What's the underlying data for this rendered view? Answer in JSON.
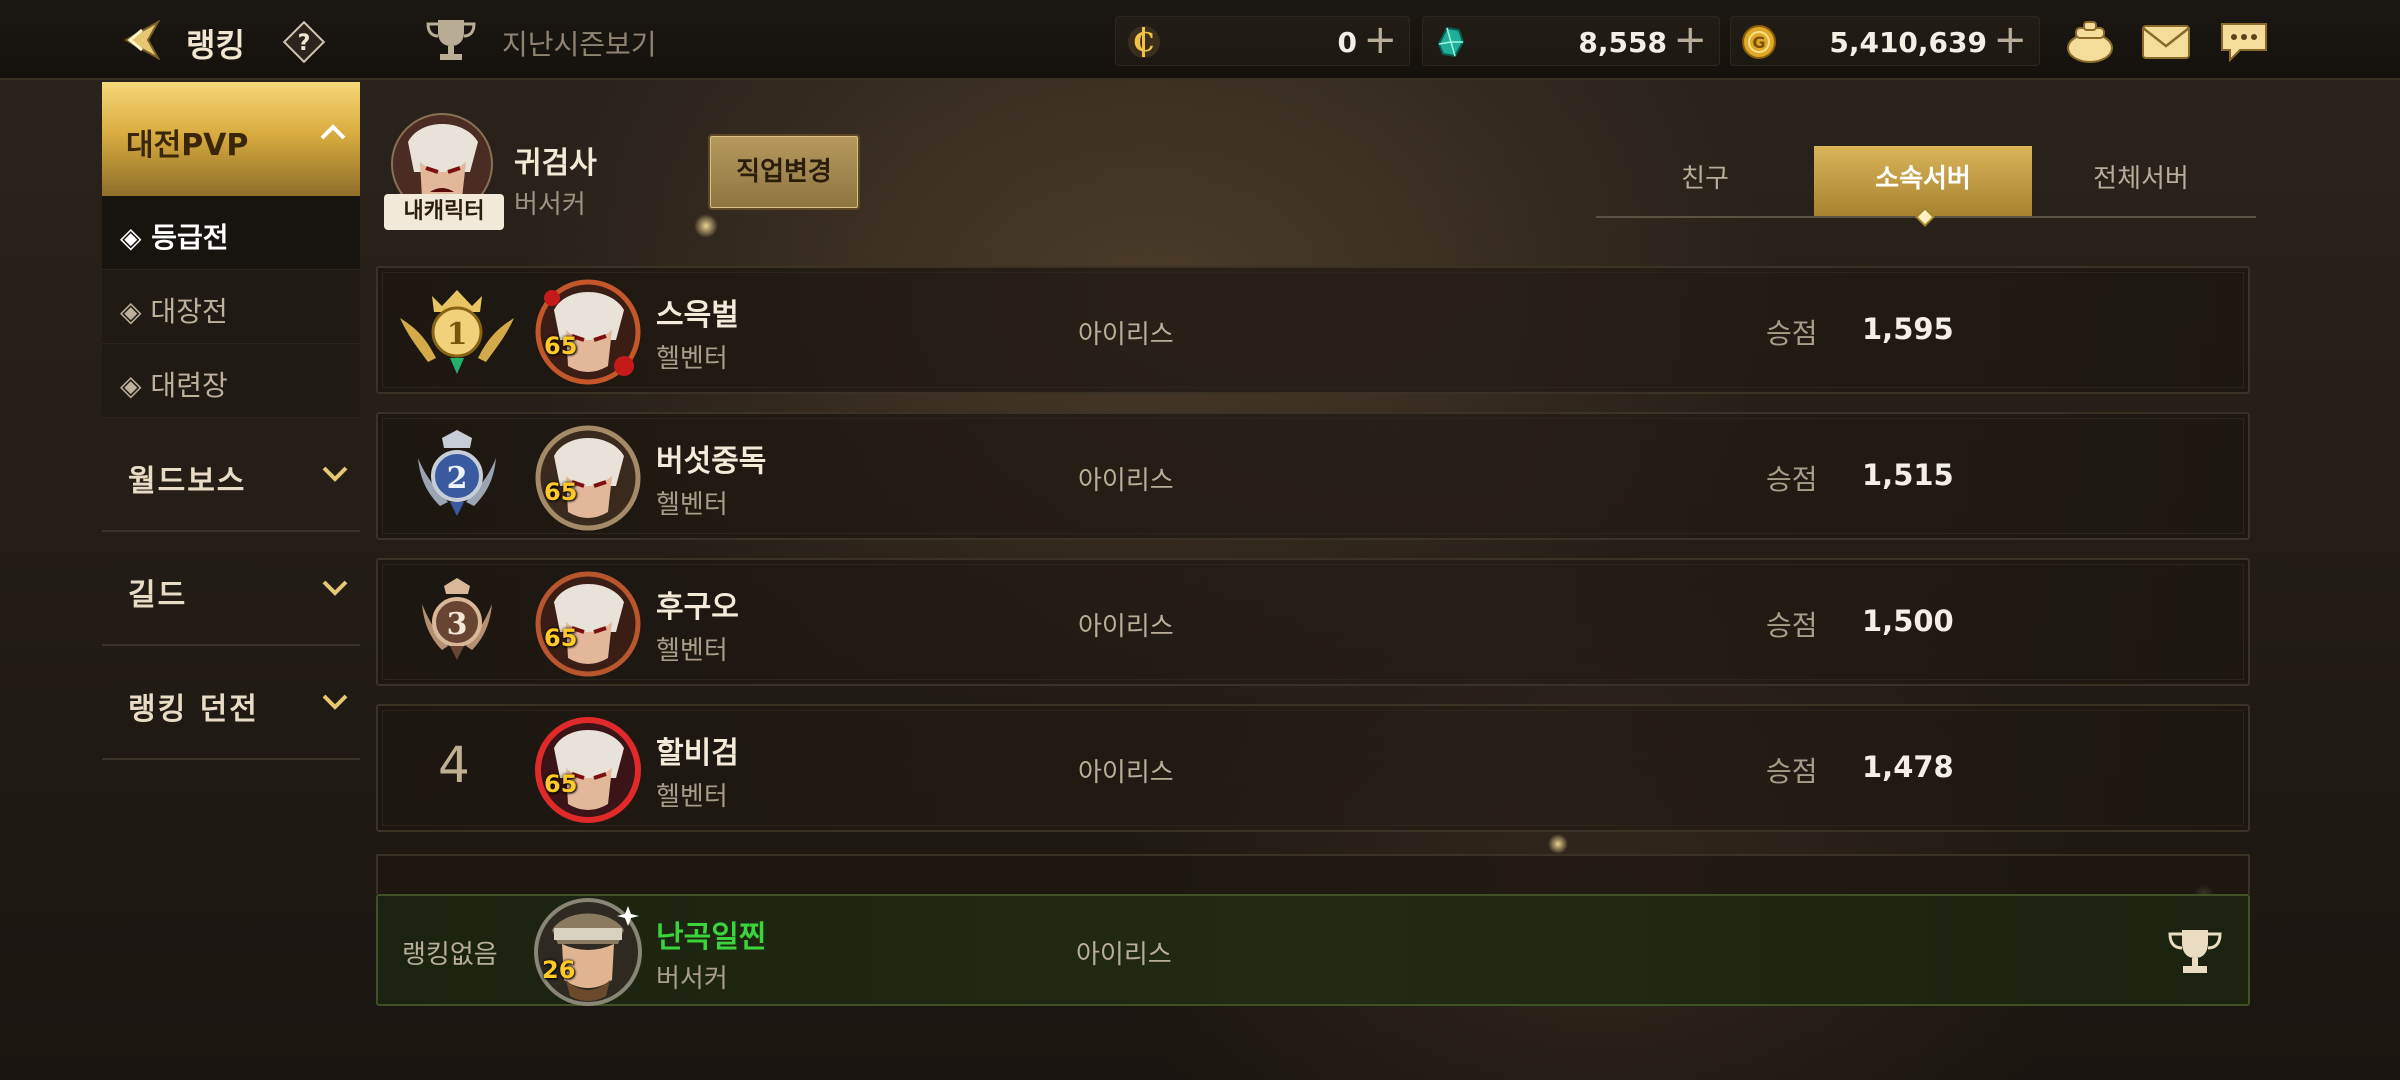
{
  "header": {
    "title": "랭킹",
    "last_season": "지난시즌보기",
    "currencies": [
      {
        "name": "c-coin",
        "value": "0"
      },
      {
        "name": "gem",
        "value": "8,558"
      },
      {
        "name": "gold",
        "value": "5,410,639"
      }
    ],
    "plus": "+"
  },
  "sidebar": {
    "groups": [
      {
        "label": "대전PVP",
        "expanded": true,
        "items": [
          {
            "label": "◈ 등급전",
            "active": true
          },
          {
            "label": "◈ 대장전",
            "active": false
          },
          {
            "label": "◈ 대련장",
            "active": false
          }
        ]
      },
      {
        "label": "월드보스",
        "expanded": false
      },
      {
        "label": "길드",
        "expanded": false
      },
      {
        "label": "랭킹 던전",
        "expanded": false
      }
    ]
  },
  "my_character": {
    "badge": "내캐릭터",
    "name": "귀검사",
    "class": "버서커",
    "job_change_label": "직업변경"
  },
  "tabs": [
    {
      "label": "친구",
      "active": false
    },
    {
      "label": "소속서버",
      "active": true
    },
    {
      "label": "전체서버",
      "active": false
    }
  ],
  "ranking": {
    "score_label": "승점",
    "rows": [
      {
        "rank": "1",
        "level": "65",
        "name": "스윽벌",
        "class": "헬벤터",
        "server": "아이리스",
        "score": "1,595"
      },
      {
        "rank": "2",
        "level": "65",
        "name": "버섯중독",
        "class": "헬벤터",
        "server": "아이리스",
        "score": "1,515"
      },
      {
        "rank": "3",
        "level": "65",
        "name": "후구오",
        "class": "헬벤터",
        "server": "아이리스",
        "score": "1,500"
      },
      {
        "rank": "4",
        "level": "65",
        "name": "할비검",
        "class": "헬벤터",
        "server": "아이리스",
        "score": "1,478"
      }
    ]
  },
  "my_rank": {
    "rank_text": "랭킹없음",
    "level": "26",
    "name": "난곡일찐",
    "class": "버서커",
    "server": "아이리스"
  },
  "colors": {
    "accent_gold": "#d9b45a",
    "my_name_green": "#3bd43b",
    "level_yellow": "#ffc928"
  }
}
